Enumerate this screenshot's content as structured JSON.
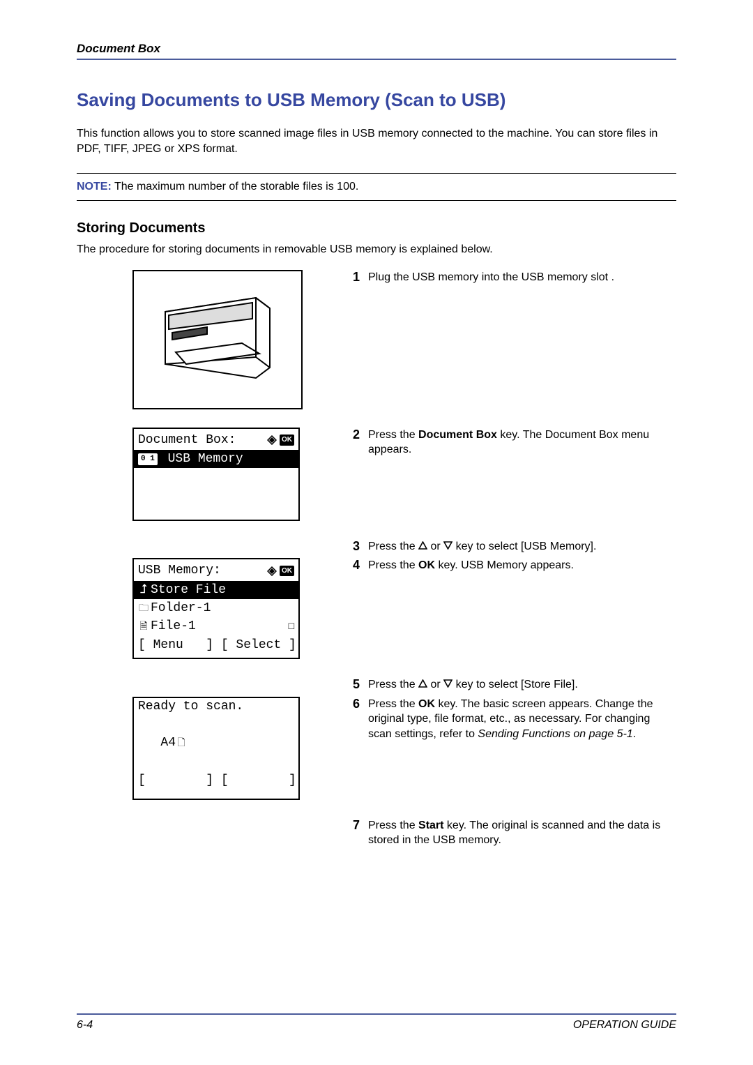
{
  "header": {
    "chapter": "Document Box"
  },
  "title": "Saving Documents to USB Memory (Scan to USB)",
  "intro": "This function allows you to store scanned image files in USB memory connected to the machine. You can store files in PDF, TIFF, JPEG or XPS format.",
  "note": {
    "label": "NOTE:",
    "text": " The maximum number of the storable files is 100."
  },
  "subheading": "Storing Documents",
  "subintro": "The procedure for storing documents in removable USB memory is explained below.",
  "steps": {
    "s1": {
      "num": "1",
      "text": "Plug the USB memory into the USB memory slot ."
    },
    "s2": {
      "num": "2",
      "text_a": "Press the ",
      "bold": "Document Box",
      "text_b": " key. The Document Box menu appears."
    },
    "s3": {
      "num": "3",
      "text_a": "Press the ",
      "text_b": " or ",
      "text_c": " key to select [USB Memory]."
    },
    "s4": {
      "num": "4",
      "text_a": "Press the ",
      "bold": "OK",
      "text_b": " key. USB Memory appears."
    },
    "s5": {
      "num": "5",
      "text_a": "Press the ",
      "text_b": " or ",
      "text_c": " key to select [Store File]."
    },
    "s6": {
      "num": "6",
      "text_a": "Press the ",
      "bold": "OK",
      "text_b": " key. The basic screen appears. Change the original type, file format, etc., as necessary. For changing scan settings, refer to ",
      "italic": "Sending Functions on page 5-1",
      "text_c": "."
    },
    "s7": {
      "num": "7",
      "text_a": "Press the ",
      "bold": "Start",
      "text_b": " key. The original is scanned and the data is stored in the USB memory."
    }
  },
  "lcd1": {
    "title": "Document Box:",
    "item1_num": "0 1",
    "item1": " USB Memory"
  },
  "lcd2": {
    "title": "USB Memory:",
    "line1": "Store File",
    "line2": "Folder-1",
    "line3": "File-1",
    "buttons": "[ Menu   ] [ Select ]"
  },
  "lcd3": {
    "line1": "Ready to scan.",
    "line2": "   A4",
    "buttons": "[        ] [        ]"
  },
  "ok_label": "OK",
  "footer": {
    "page": "6-4",
    "guide": "OPERATION GUIDE"
  }
}
